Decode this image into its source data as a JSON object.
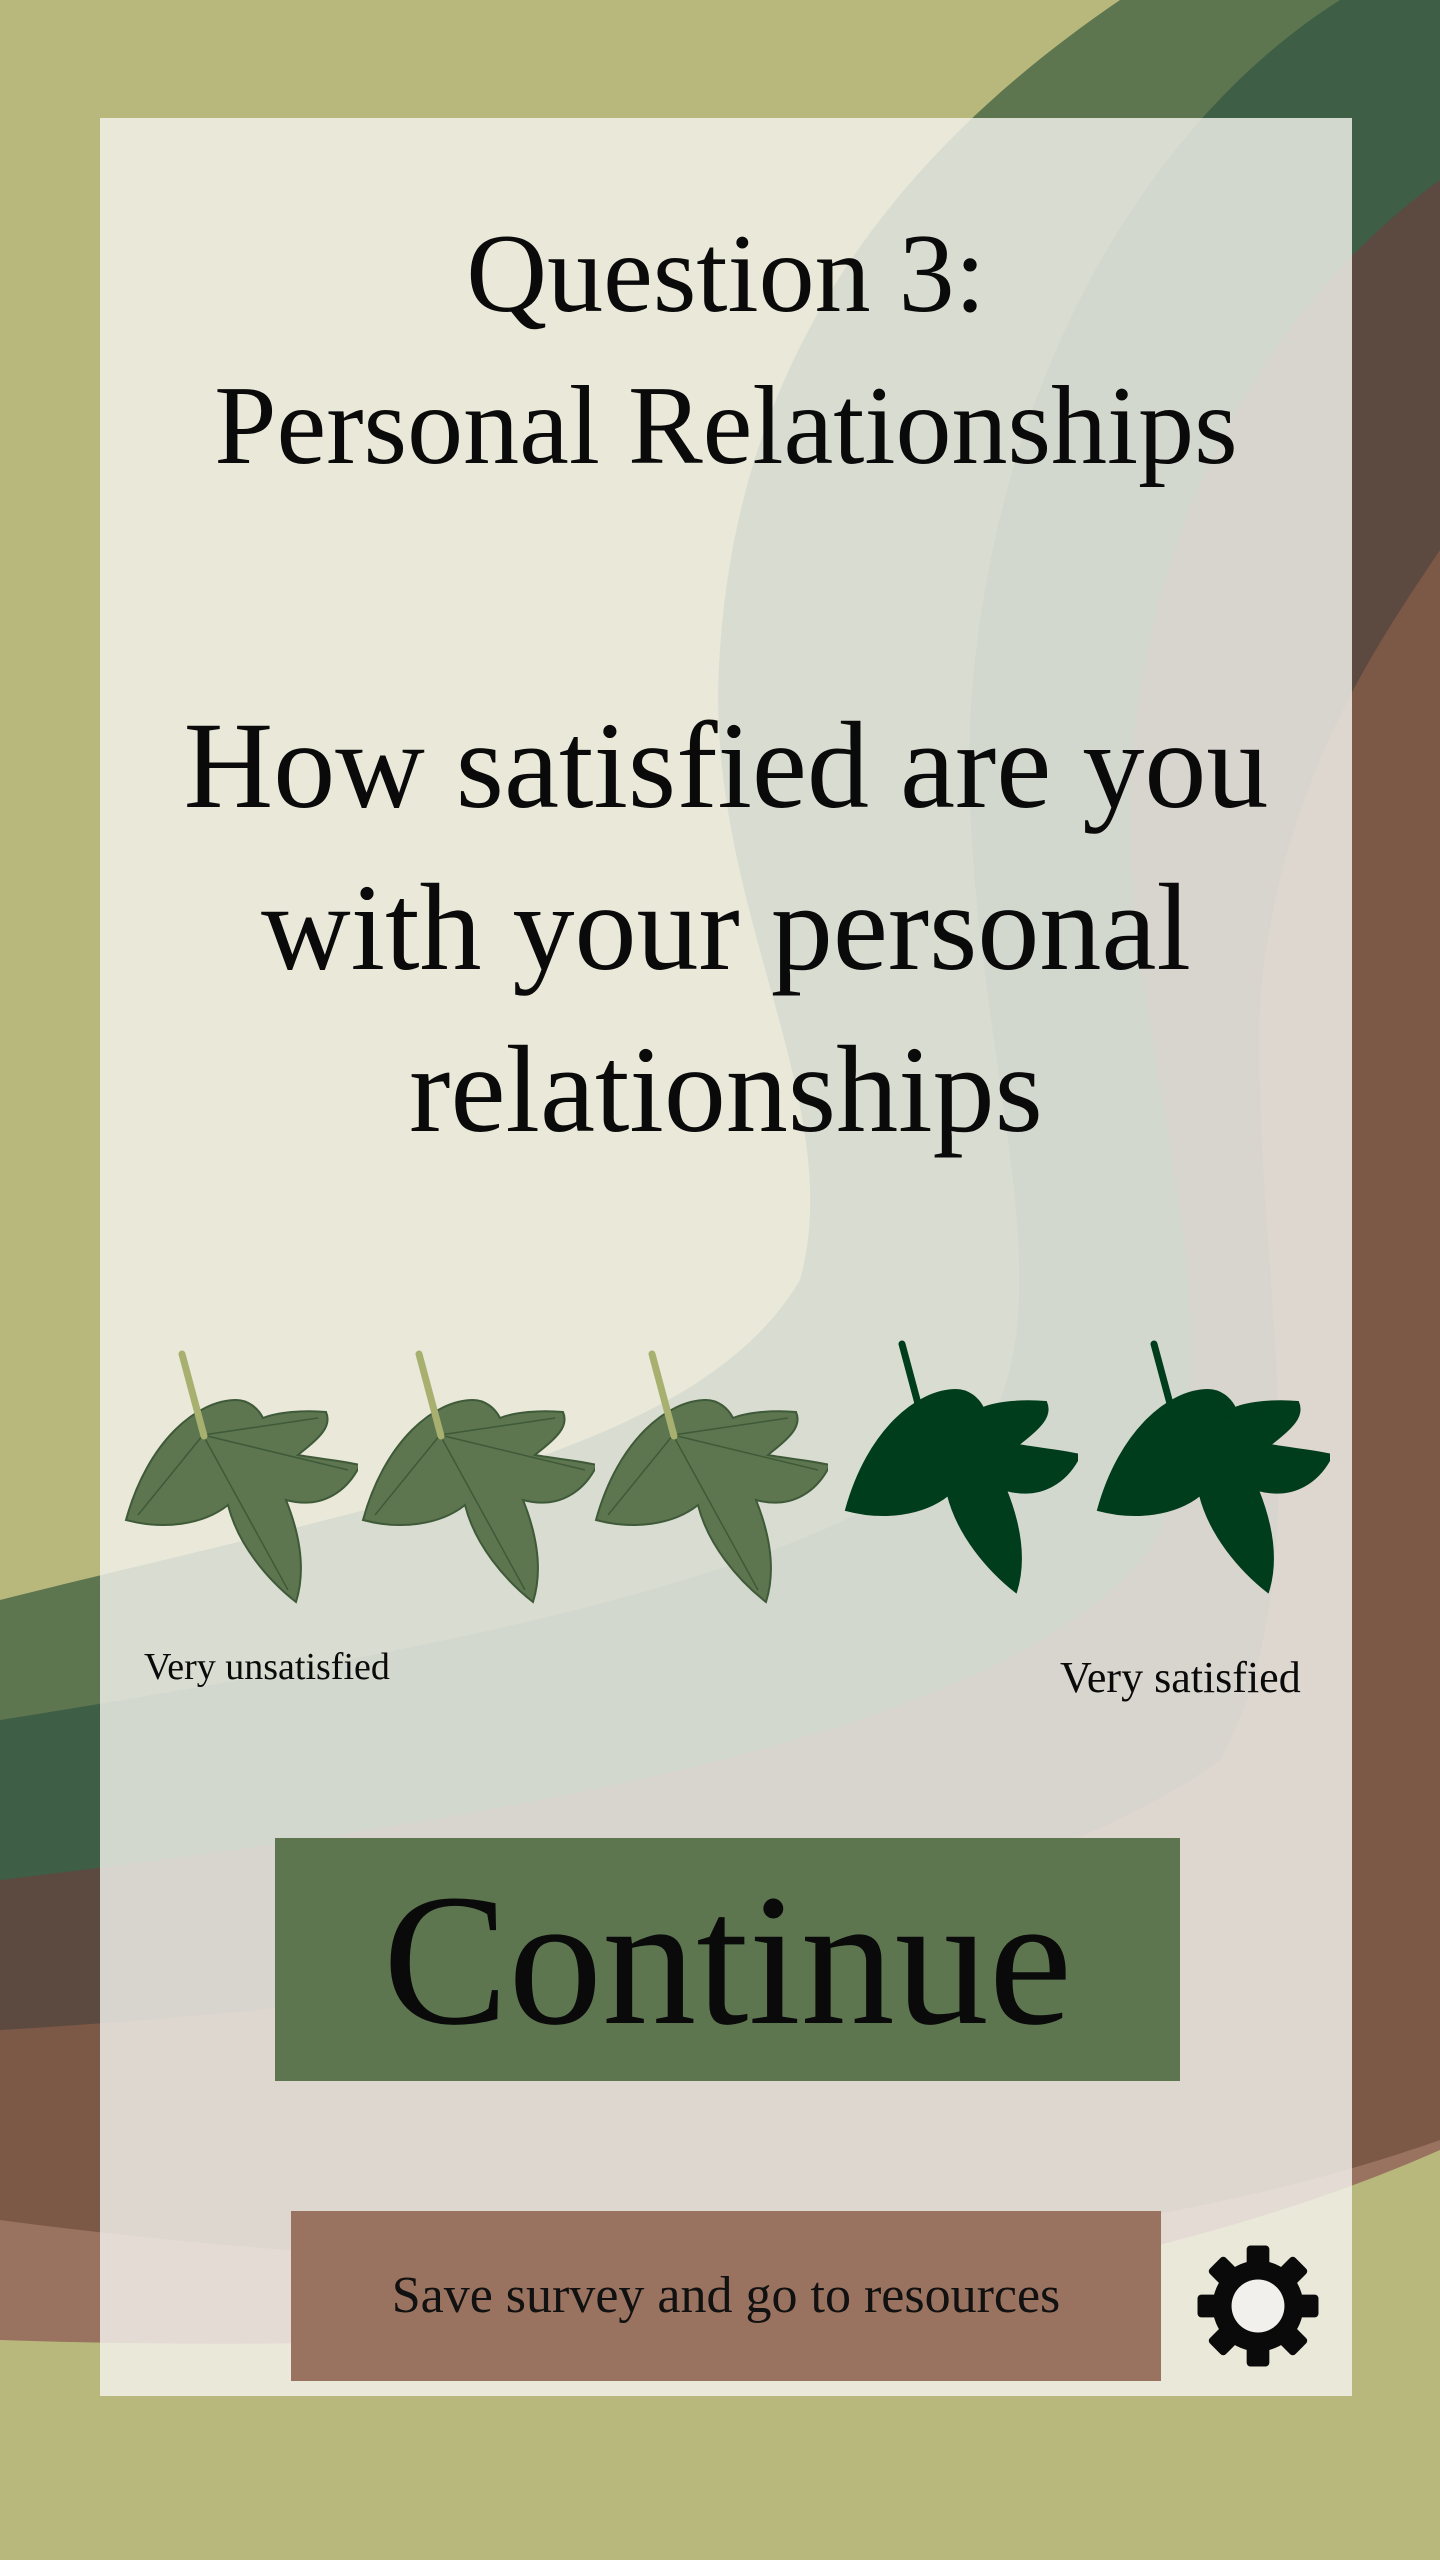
{
  "survey": {
    "title_line1": "Question 3:",
    "title_line2": "Personal Relationships",
    "question_line1": "How satisfied are you",
    "question_line2": "with your personal",
    "question_line3": "relationships",
    "scale_min_label": "Very unsatisfied",
    "scale_max_label": "Very satisfied",
    "rating": {
      "max": 5,
      "highlighted_count": 2
    },
    "leaf_icon": "maple-leaf-icon"
  },
  "actions": {
    "continue_label": "Continue",
    "save_label": "Save survey and go to resources",
    "settings_icon": "gear-icon"
  },
  "colors": {
    "page_bg": "#b8b77c",
    "leaf_light": "#5d7650",
    "leaf_light_stem": "#a8b070",
    "leaf_dark": "#003d1c",
    "continue_bg": "#5d7650",
    "save_bg": "#9a7260",
    "wave_green": "#5d7650",
    "wave_dark_green": "#3e5e46",
    "wave_dark_brown": "#5c4940",
    "wave_brown": "#7c5846",
    "wave_tan": "#9a7260"
  }
}
